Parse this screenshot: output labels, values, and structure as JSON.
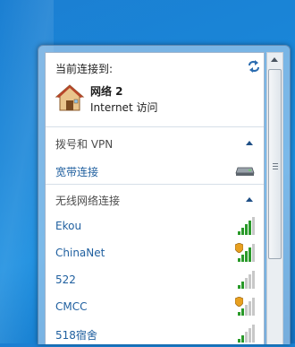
{
  "current": {
    "label": "当前连接到:",
    "network_name": "网络  2",
    "access": "Internet 访问"
  },
  "sections": {
    "dialup": {
      "title": "拨号和 VPN",
      "items": [
        {
          "label": "宽带连接",
          "icon": "modem-icon"
        }
      ]
    },
    "wireless": {
      "title": "无线网络连接",
      "networks": [
        {
          "label": "Ekou",
          "signal": 4,
          "secured": false
        },
        {
          "label": "ChinaNet",
          "signal": 4,
          "secured": true
        },
        {
          "label": "522",
          "signal": 2,
          "secured": false
        },
        {
          "label": "CMCC",
          "signal": 2,
          "secured": true
        },
        {
          "label": "518宿舍",
          "signal": 2,
          "secured": false
        }
      ]
    }
  },
  "colors": {
    "link": "#1f5f9f",
    "signal_on": "#2a9a2a",
    "signal_off": "#c8c8c8",
    "shield": "#e8a020"
  }
}
